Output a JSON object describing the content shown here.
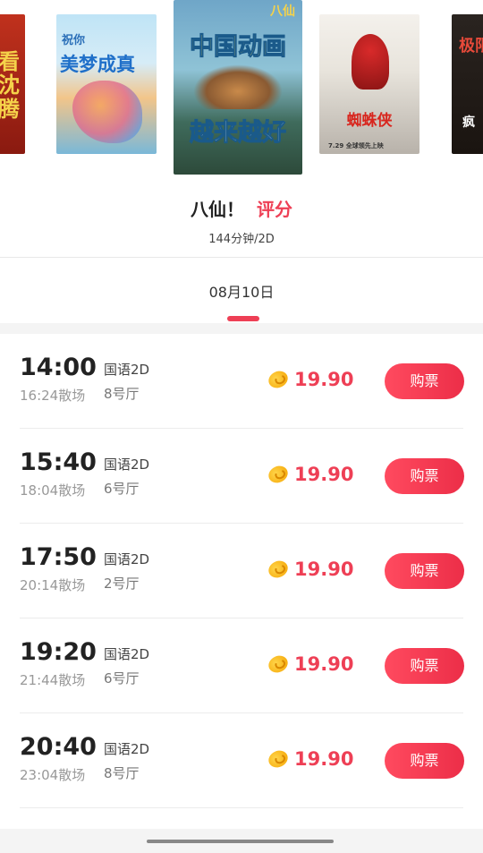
{
  "posters": [
    {
      "name": "poster-left-partial",
      "text": "看沈腾"
    },
    {
      "name": "poster-haoyun",
      "small": "祝你",
      "big": "美梦成真"
    },
    {
      "name": "poster-baxian-selected",
      "logo": "八仙",
      "top": "中国动画",
      "bottom": "越来越好"
    },
    {
      "name": "poster-spiderman",
      "title": "蜘蛛侠",
      "date": "7.29 全球领先上映"
    },
    {
      "name": "poster-right-partial",
      "text": "极限",
      "sub": "疯"
    }
  ],
  "movie": {
    "title": "八仙！",
    "score_label": "评分",
    "meta": "144分钟/2D"
  },
  "date_tab": {
    "label": "08月10日"
  },
  "showtimes": [
    {
      "start": "14:00",
      "end": "16:24散场",
      "lang": "国语2D",
      "hall": "8号厅",
      "price": "19.90",
      "buy": "购票"
    },
    {
      "start": "15:40",
      "end": "18:04散场",
      "lang": "国语2D",
      "hall": "6号厅",
      "price": "19.90",
      "buy": "购票"
    },
    {
      "start": "17:50",
      "end": "20:14散场",
      "lang": "国语2D",
      "hall": "2号厅",
      "price": "19.90",
      "buy": "购票"
    },
    {
      "start": "19:20",
      "end": "21:44散场",
      "lang": "国语2D",
      "hall": "6号厅",
      "price": "19.90",
      "buy": "购票"
    },
    {
      "start": "20:40",
      "end": "23:04散场",
      "lang": "国语2D",
      "hall": "8号厅",
      "price": "19.90",
      "buy": "购票"
    }
  ],
  "colors": {
    "accent": "#ee3f55",
    "coin": "#f5a300"
  }
}
